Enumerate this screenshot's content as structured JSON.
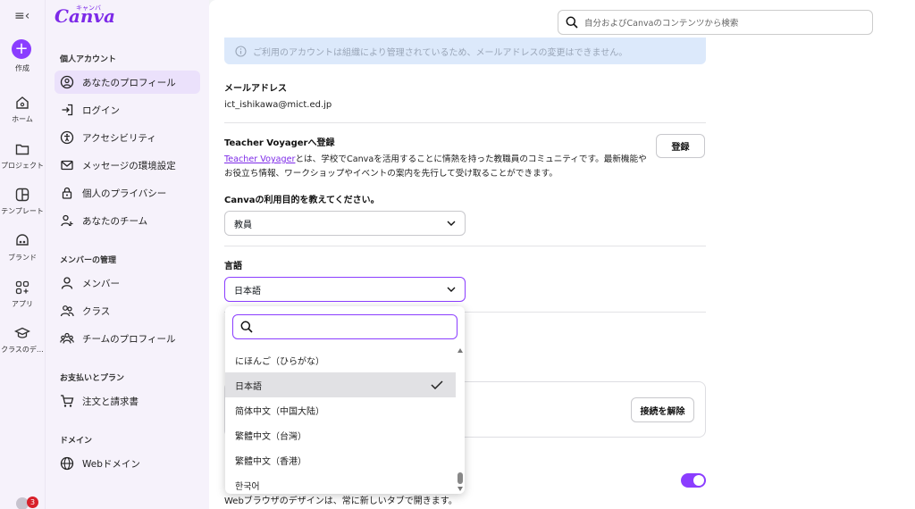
{
  "rail": {
    "create": "作成",
    "items": [
      {
        "label": "ホーム",
        "icon": "home-icon"
      },
      {
        "label": "プロジェクト",
        "icon": "folder-icon"
      },
      {
        "label": "テンプレート",
        "icon": "template-icon"
      },
      {
        "label": "ブランド",
        "icon": "brand-icon"
      },
      {
        "label": "アプリ",
        "icon": "apps-icon"
      },
      {
        "label": "クラスのデ…",
        "icon": "class-icon"
      }
    ],
    "notification_count": "3"
  },
  "panel": {
    "logo": "Canva",
    "logo_sub": "キャンバ",
    "sections": {
      "personal": "個人アカウント",
      "members": "メンバーの管理",
      "billing": "お支払いとプラン",
      "domain": "ドメイン"
    },
    "items": {
      "profile": "あなたのプロフィール",
      "login": "ログイン",
      "accessibility": "アクセシビリティ",
      "message_settings": "メッセージの環境設定",
      "privacy": "個人のプライバシー",
      "team": "あなたのチーム",
      "members": "メンバー",
      "classes": "クラス",
      "team_profile": "チームのプロフィール",
      "orders": "注文と請求書",
      "web_domain": "Webドメイン"
    }
  },
  "search": {
    "placeholder": "自分およびCanvaのコンテンツから検索"
  },
  "main": {
    "notice": "ご利用のアカウントは組織により管理されているため、メールアドレスの変更はできません。",
    "email_label": "メールアドレス",
    "email_value": "ict_ishikawa@mict.ed.jp",
    "tv_label": "Teacher Voyagerへ登録",
    "tv_button": "登録",
    "tv_link": "Teacher Voyager",
    "tv_desc": "とは、学校でCanvaを活用することに情熱を持った教職員のコミュニティです。最新機能やお役立ち情報、ワークショップやイベントの案内を先行して受け取ることができます。",
    "purpose_label": "Canvaの利用目的を教えてください。",
    "purpose_value": "教員",
    "language_label": "言語",
    "language_value": "日本語",
    "disconnect_button": "接続を解除",
    "browser_text": "Webブラウザのデザインは、常に新しいタブで開きます。"
  },
  "dropdown": {
    "search_placeholder": "",
    "options": [
      {
        "label": "にほんご（ひらがな）",
        "selected": false
      },
      {
        "label": "日本語",
        "selected": true
      },
      {
        "label": "简体中文（中国大陆）",
        "selected": false
      },
      {
        "label": "繁體中文（台灣）",
        "selected": false
      },
      {
        "label": "繁體中文（香港）",
        "selected": false
      },
      {
        "label": "한국어",
        "selected": false
      }
    ]
  },
  "colors": {
    "accent": "#8b3dff",
    "brand": "#7d2ae8",
    "notice_bg": "#dce9fb"
  }
}
